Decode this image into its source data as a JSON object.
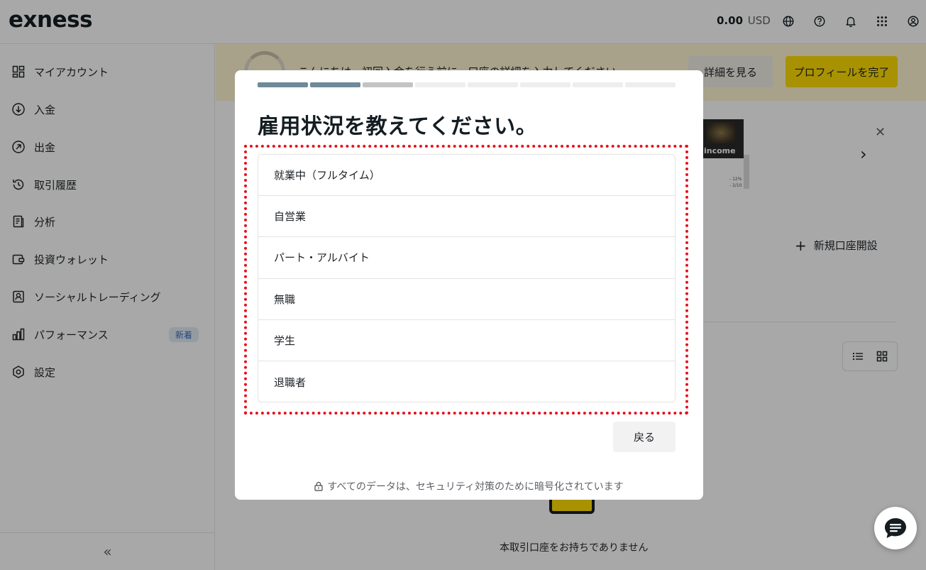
{
  "header": {
    "logo": "exness",
    "balance_amount": "0.00",
    "balance_currency": "USD"
  },
  "sidebar": {
    "items": [
      {
        "label": "マイアカウント",
        "icon": "grid-icon"
      },
      {
        "label": "入金",
        "icon": "arrow-down-circle-icon"
      },
      {
        "label": "出金",
        "icon": "arrow-up-right-circle-icon"
      },
      {
        "label": "取引履歴",
        "icon": "history-icon"
      },
      {
        "label": "分析",
        "icon": "document-icon"
      },
      {
        "label": "投資ウォレット",
        "icon": "wallet-icon"
      },
      {
        "label": "ソーシャルトレーディング",
        "icon": "social-trading-icon"
      },
      {
        "label": "パフォーマンス",
        "icon": "bar-chart-icon",
        "badge": "新着"
      },
      {
        "label": "設定",
        "icon": "settings-icon"
      }
    ],
    "collapse_label": "«"
  },
  "banner": {
    "text": "こんにちは。初回入金を行う前に、口座の詳細を入力してください。",
    "details_button": "詳細を見る",
    "profile_button": "プロフィールを完了"
  },
  "promo": {
    "image_text": "income",
    "stat_line1": "- 12%",
    "stat_line2": "- 2/10"
  },
  "accounts": {
    "new_account_label": "新規口座開設",
    "empty_text": "本取引口座をお持ちでありません"
  },
  "modal": {
    "progress_total": 8,
    "progress_done": 2,
    "progress_current": 3,
    "title": "雇用状況を教えてください。",
    "options": [
      "就業中（フルタイム）",
      "自営業",
      "パート・アルバイト",
      "無職",
      "学生",
      "退職者"
    ],
    "back_button": "戻る",
    "security_note": "すべてのデータは、セキュリティ対策のために暗号化されています"
  },
  "colors": {
    "brand_yellow": "#ffde02",
    "progress_done": "#6f8a99",
    "highlight_red": "#e8101a"
  }
}
